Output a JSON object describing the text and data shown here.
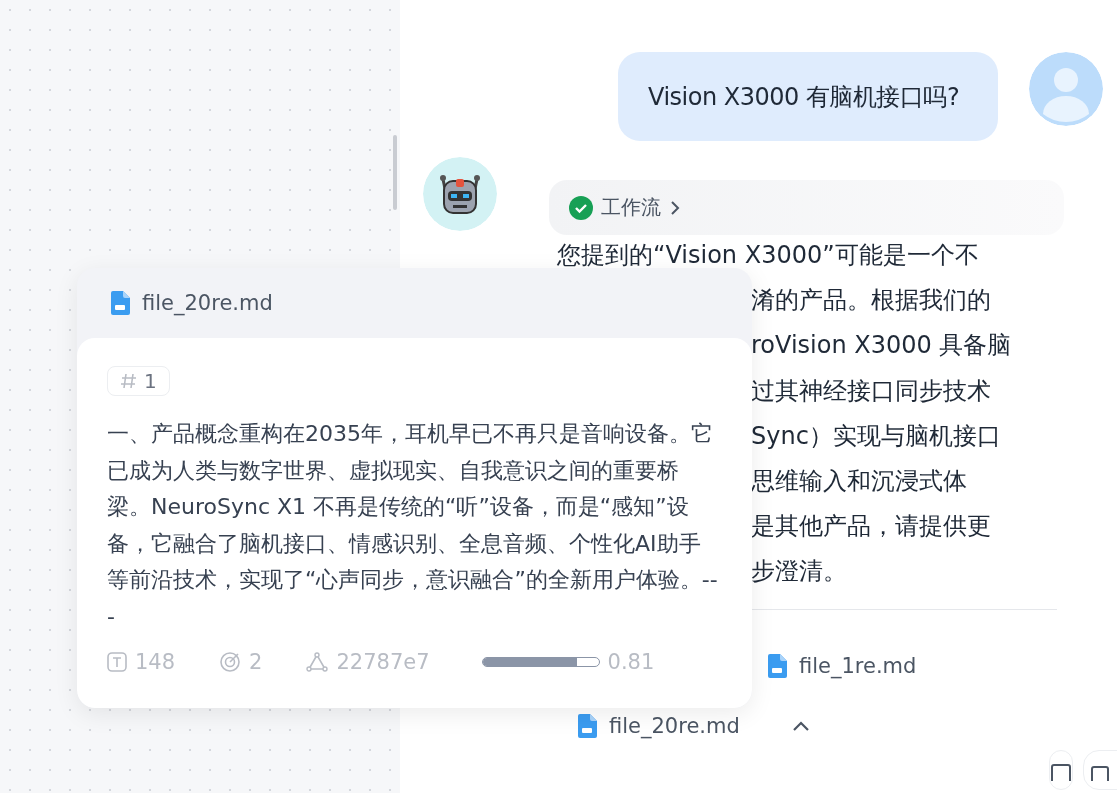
{
  "chat": {
    "user_message": "Vision X3000 有脑机接口吗?",
    "workflow": {
      "label": "工作流",
      "done": true
    },
    "answer_lines": [
      "您提到的“Vision X3000”可能是一个不",
      "淆的产品。根据我们的",
      "roVision X3000 具备脑",
      "过其神经接口同步技术",
      "Sync）实现与脑机接口",
      "思维输入和沉浸式体",
      "是其他产品，请提供更",
      "步澄清。"
    ],
    "sources": [
      {
        "name": "file_1re.md"
      },
      {
        "name": "file_20re.md"
      }
    ],
    "sources_expanded": true
  },
  "popover": {
    "file": "file_20re.md",
    "tag": "1",
    "text": "一、产品概念重构在2035年，耳机早已不再只是音响设备。它已成为人类与数字世界、虚拟现实、自我意识之间的重要桥梁。NeuroSync X1 不再是传统的“听”设备，而是“感知”设备，它融合了脑机接口、情感识别、全息音频、个性化AI助手等前沿技术，实现了“心声同步，意识融合”的全新用户体验。---",
    "stats": {
      "chars": "148",
      "hits": "2",
      "hash": "22787e7",
      "score": "0.81",
      "level": 0.81
    }
  }
}
